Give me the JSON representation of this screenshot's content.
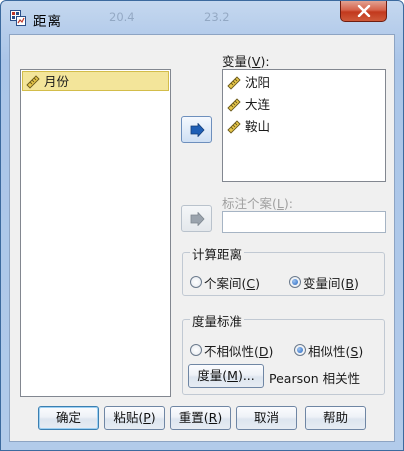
{
  "window": {
    "title": "距离",
    "ghost_values": [
      "20.4",
      "23.2"
    ]
  },
  "source_list": {
    "items": [
      {
        "label": "月份",
        "icon": "ruler-scale-icon",
        "selected": true
      }
    ]
  },
  "variables": {
    "label_prefix": "变量(",
    "mnemonic": "V",
    "label_suffix": "):",
    "items": [
      {
        "label": "沈阳",
        "icon": "ruler-scale-icon"
      },
      {
        "label": "大连",
        "icon": "ruler-scale-icon"
      },
      {
        "label": "鞍山",
        "icon": "ruler-scale-icon"
      }
    ]
  },
  "label_cases": {
    "label_prefix": "标注个案(",
    "mnemonic": "L",
    "label_suffix": "):",
    "enabled": false,
    "value": ""
  },
  "compute_distance": {
    "title": "计算距离",
    "options": [
      {
        "prefix": "个案间(",
        "mnemonic": "C",
        "suffix": ")",
        "selected": false
      },
      {
        "prefix": "变量间(",
        "mnemonic": "B",
        "suffix": ")",
        "selected": true
      }
    ]
  },
  "measure": {
    "title": "度量标准",
    "options": [
      {
        "prefix": "不相似性(",
        "mnemonic": "D",
        "suffix": ")",
        "selected": false
      },
      {
        "prefix": "相似性(",
        "mnemonic": "S",
        "suffix": ")",
        "selected": true
      }
    ],
    "button": {
      "prefix": "度量(",
      "mnemonic": "M",
      "suffix": ")..."
    },
    "current": "Pearson 相关性"
  },
  "buttons": [
    {
      "prefix": "确定",
      "mnemonic": "",
      "suffix": "",
      "default": true
    },
    {
      "prefix": "粘贴(",
      "mnemonic": "P",
      "suffix": ")",
      "default": false
    },
    {
      "prefix": "重置(",
      "mnemonic": "R",
      "suffix": ")",
      "default": false
    },
    {
      "prefix": "取消",
      "mnemonic": "",
      "suffix": "",
      "default": false
    },
    {
      "prefix": "帮助",
      "mnemonic": "",
      "suffix": "",
      "default": false
    }
  ],
  "colors": {
    "accent_blue": "#2466c1",
    "selection": "#f3e59a",
    "close_red": "#c2391d"
  }
}
